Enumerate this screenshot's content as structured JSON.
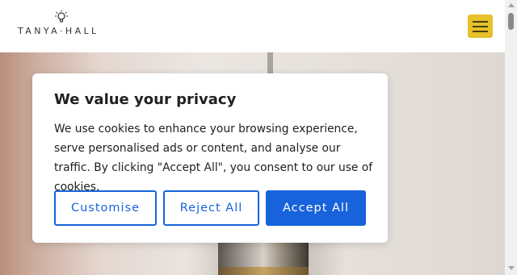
{
  "header": {
    "logo_text": "TANYA·HALL",
    "logo_icon": "lightbulb-icon",
    "menu_icon": "hamburger-menu-icon",
    "menu_color": "#e6c12a"
  },
  "cookie_banner": {
    "title": "We value your privacy",
    "message": "We use cookies to enhance your browsing experience, serve personalised ads or content, and analyse our traffic. By clicking \"Accept All\", you consent to our use of cookies.",
    "customise_label": "Customise",
    "reject_label": "Reject All",
    "accept_label": "Accept All",
    "accent_color": "#1863dc"
  }
}
